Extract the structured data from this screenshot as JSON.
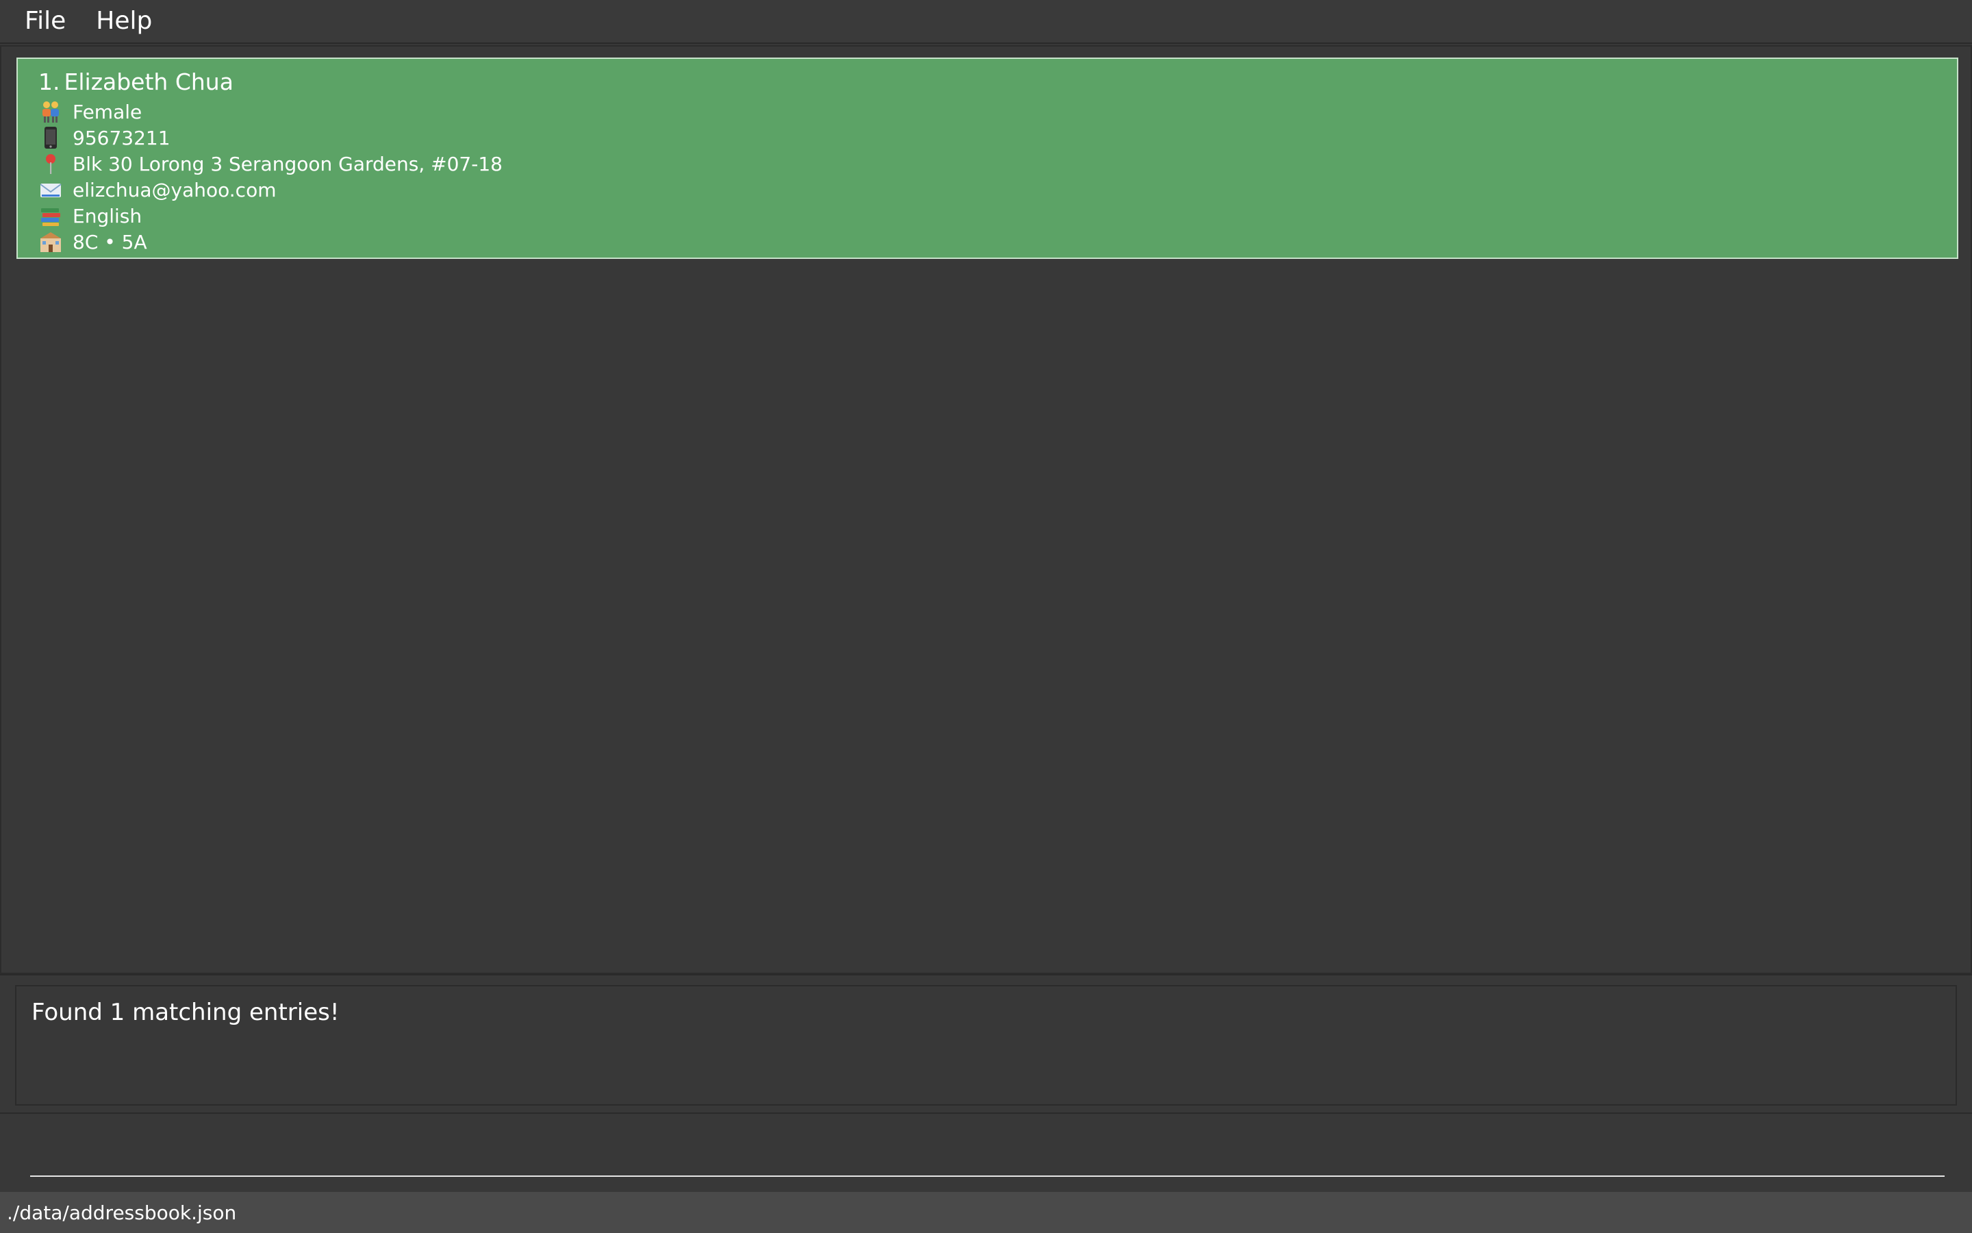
{
  "menu": {
    "file_label": "File",
    "help_label": "Help"
  },
  "person_list": {
    "selected_index": 0,
    "persons": [
      {
        "index_label": "1.",
        "name": "Elizabeth Chua",
        "gender": "Female",
        "phone": "95673211",
        "address": "Blk 30 Lorong 3 Serangoon Gardens, #07-18",
        "email": "elizchua@yahoo.com",
        "subject": "English",
        "classes": "8C • 5A"
      }
    ]
  },
  "icons": {
    "gender": "people-icon",
    "phone": "mobile-phone-icon",
    "address": "location-pin-icon",
    "email": "envelope-icon",
    "subject": "books-icon",
    "classes": "school-building-icon"
  },
  "result_display": {
    "message": "Found 1 matching entries!"
  },
  "command_box": {
    "value": ""
  },
  "status_bar": {
    "file_path": "./data/addressbook.json"
  },
  "colors": {
    "background": "#383838",
    "selected_card": "#5ca366",
    "status_bar": "#4a4a4a",
    "text": "#ffffff"
  }
}
